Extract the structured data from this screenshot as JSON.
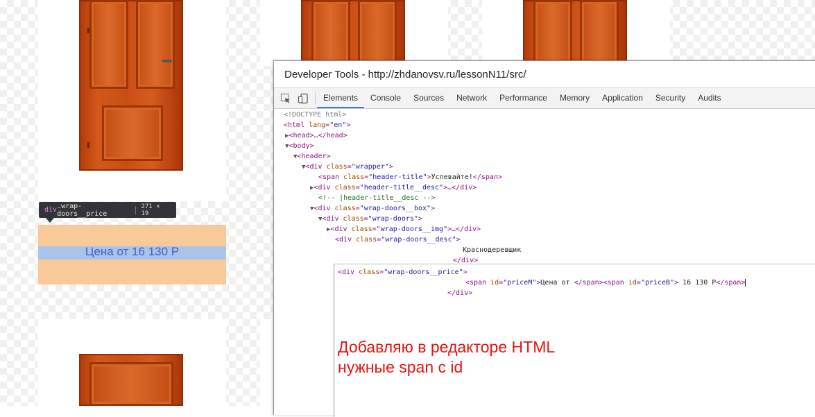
{
  "page": {
    "price_text": "Цена от 16 130 Р"
  },
  "tooltip": {
    "tag": "div",
    "class_name": ".wrap-doors__price",
    "dimensions": "271 × 19"
  },
  "devtools": {
    "title": "Developer Tools - http://zhdanovsv.ru/lessonN11/src/",
    "tabs": [
      "Elements",
      "Console",
      "Sources",
      "Network",
      "Performance",
      "Memory",
      "Application",
      "Security",
      "Audits"
    ],
    "active_tab": "Elements",
    "tree": {
      "doctype": "<!DOCTYPE html>",
      "html_open": "<html ",
      "html_attr": "lang",
      "html_val": "\"en\"",
      "head": "<head>…</head>",
      "body": "<body>",
      "header": "<header>",
      "wrapper_tag": "<div ",
      "wrapper_attr": "class",
      "wrapper_val": "\"wrapper\"",
      "span_title_val": "\"header-title\"",
      "span_title_text": "Успевайте!",
      "header_desc_val": "\"header-title__desc\"",
      "comment": "<!-- |header-title__desc -->",
      "box_val": "\"wrap-doors__box\"",
      "doors_val": "\"wrap-doors\"",
      "img_val": "\"wrap-doors__img\"",
      "desc_val": "\"wrap-doors__desc\"",
      "desc_text": "Краснодеревщик",
      "close_div": "</div>"
    },
    "editor": {
      "line1_val": "\"wrap-doors__price\"",
      "span1_val": "\"priceM\"",
      "span1_text": "Цена от ",
      "span2_val": "\"priceB\"",
      "span2_text": " 16 130 Р",
      "close_div": "</div>"
    }
  },
  "annotation": {
    "line1": "Добавляю в редакторе HTML",
    "line2": "нужные span с id"
  },
  "colors": {
    "annotation": "#e8130f",
    "highlight_padding": "#f8ca9a",
    "highlight_content": "#a9c4ea",
    "active_tab_underline": "#3879d9"
  }
}
